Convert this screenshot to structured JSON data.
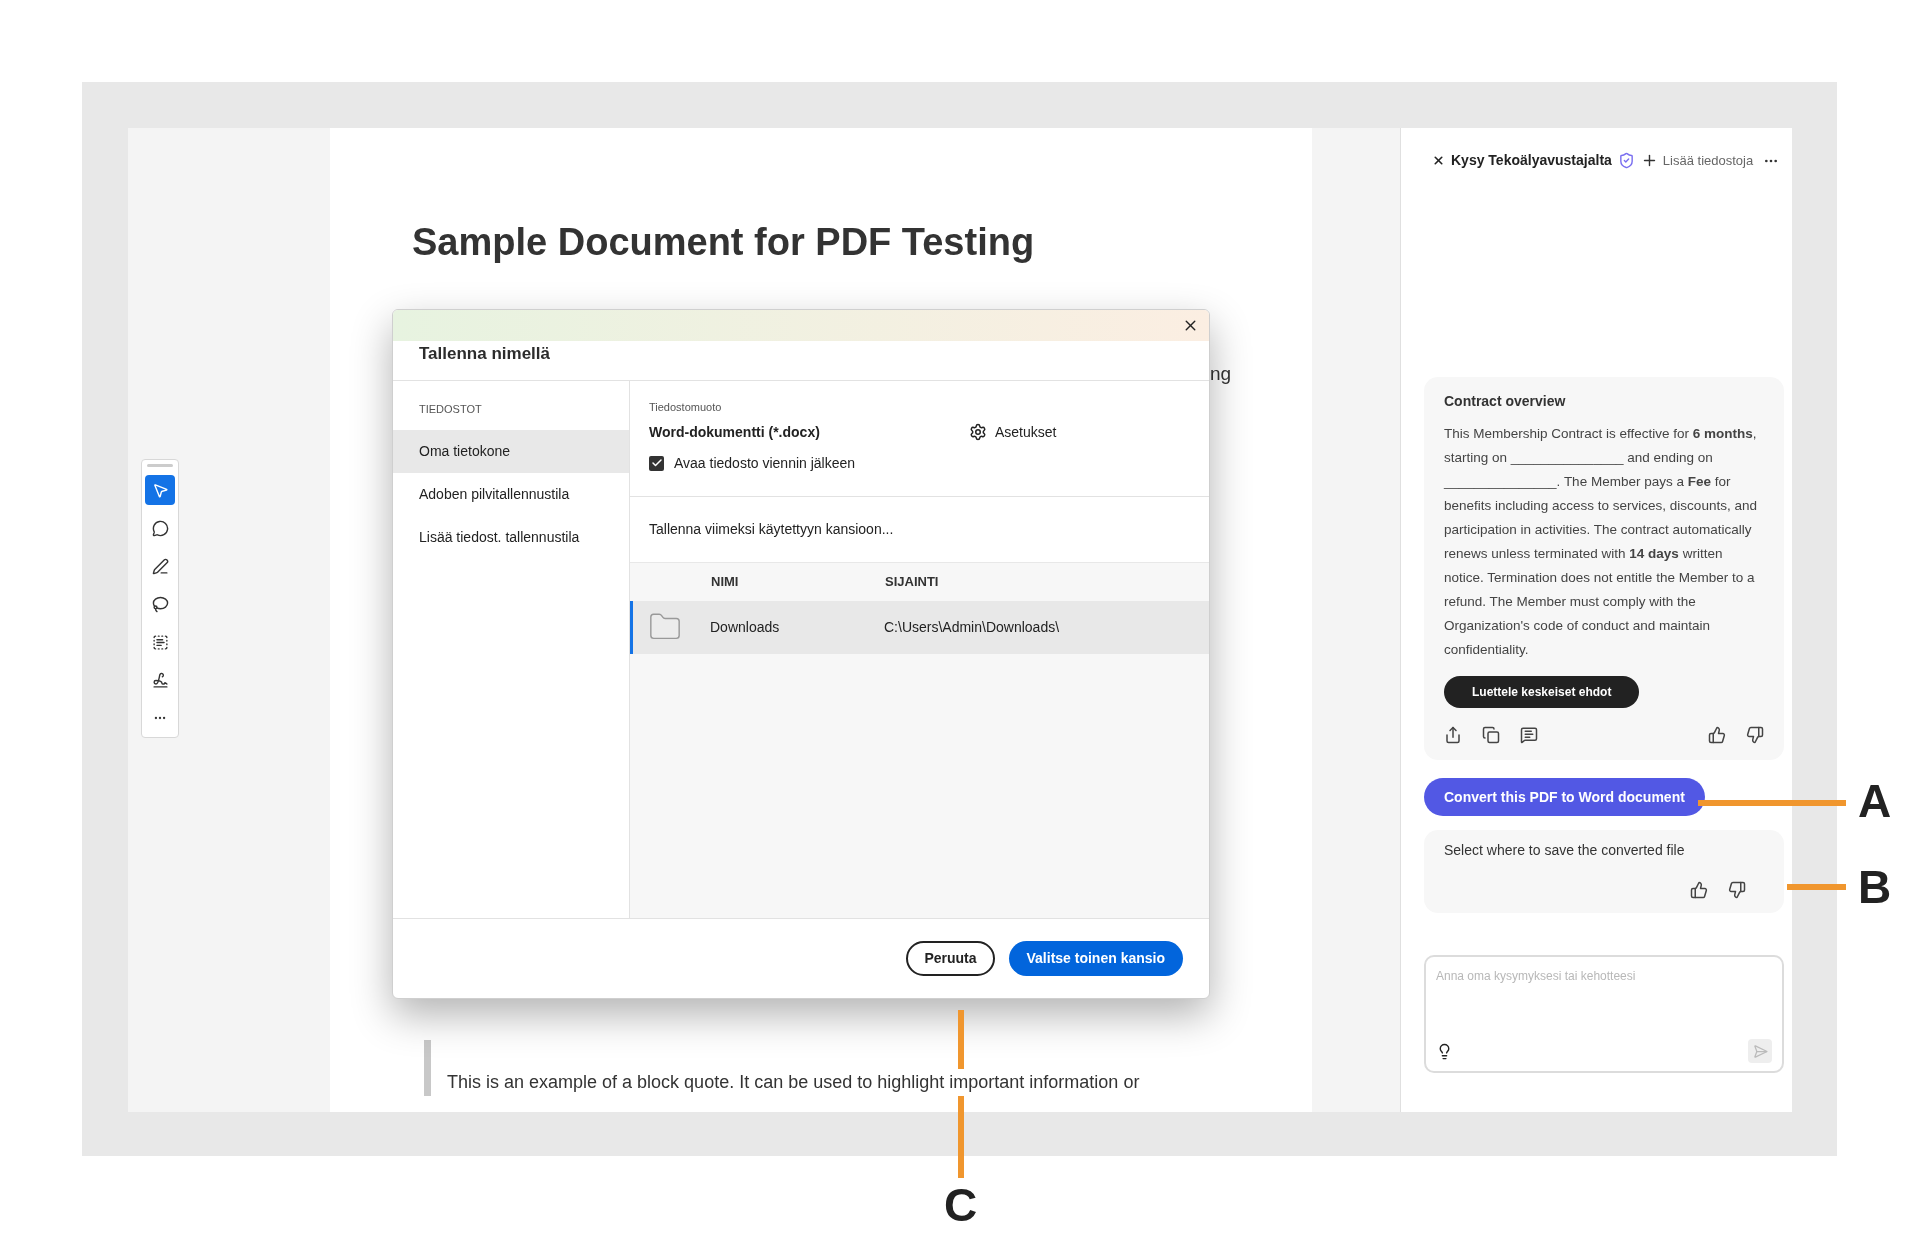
{
  "document": {
    "title": "Sample Document for PDF Testing",
    "fragment": "ng",
    "block_quote": "This is an example of a block quote. It can be used to highlight important information or"
  },
  "toolbar": {
    "tools": [
      {
        "kind": "select",
        "selected": true
      },
      {
        "kind": "comment",
        "selected": false
      },
      {
        "kind": "pen",
        "selected": false
      },
      {
        "kind": "lasso",
        "selected": false
      },
      {
        "kind": "text",
        "selected": false
      },
      {
        "kind": "sign",
        "selected": false
      },
      {
        "kind": "more",
        "selected": false
      }
    ]
  },
  "dialog": {
    "title": "Tallenna nimellä",
    "sidebar": {
      "heading": "TIEDOSTOT",
      "items": [
        {
          "label": "Oma tietokone",
          "selected": true
        },
        {
          "label": "Adoben pilvitallennustila",
          "selected": false
        },
        {
          "label": "Lisää tiedost. tallennustila",
          "selected": false
        }
      ]
    },
    "format_label": "Tiedostomuoto",
    "format_value": "Word-dokumentti (*.docx)",
    "settings": "Asetukset",
    "open_after": {
      "label": "Avaa tiedosto viennin jälkeen",
      "checked": true
    },
    "recent_label": "Tallenna viimeksi käytettyyn kansioon...",
    "table": {
      "columns": [
        "NIMI",
        "SIJAINTI"
      ],
      "rows": [
        {
          "name": "Downloads",
          "location": "C:\\Users\\Admin\\Downloads\\",
          "selected": true
        }
      ]
    },
    "buttons": [
      {
        "label": "Peruuta",
        "kind": "secondary"
      },
      {
        "label": "Valitse toinen kansio",
        "kind": "primary"
      }
    ]
  },
  "assistant": {
    "title": "Kysy Tekoälyavustajalta",
    "add_files": "Lisää tiedostoja",
    "overview": {
      "title": "Contract overview",
      "body": "This Membership Contract is effective for **6 months**, starting on _______________ and ending on _______________. The Member pays a **Fee** for benefits including access to services, discounts, and participation in activities. The contract automatically renews unless terminated with **14 days** written notice. Termination does not entitle the Member to a refund. The Member must comply with the Organization's code of conduct and maintain confidentiality.",
      "chip": "Luettele keskeiset ehdot"
    },
    "user_message": "Convert this PDF to Word document",
    "reply": "Select where to save the converted file",
    "input": {
      "placeholder": "Anna oma kysymyksesi tai kehotteesi"
    }
  },
  "callouts": [
    {
      "label": "A"
    },
    {
      "label": "B"
    },
    {
      "label": "C"
    }
  ]
}
